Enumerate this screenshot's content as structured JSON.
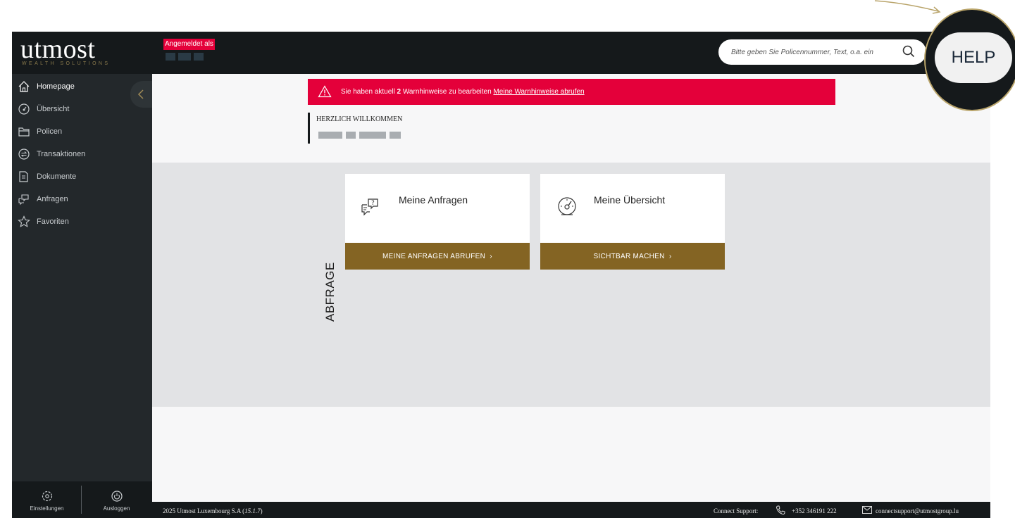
{
  "header": {
    "logo": "utmost",
    "logo_sub": "WEALTH SOLUTIONS",
    "logged_in_label": "Angemeldet als",
    "search_placeholder": "Bitte geben Sie Policennummer, Text, o.a. ein",
    "help_label": "HELP"
  },
  "sidebar": {
    "items": [
      {
        "label": "Homepage",
        "icon": "home-icon",
        "active": true
      },
      {
        "label": "Übersicht",
        "icon": "gauge-icon"
      },
      {
        "label": "Policen",
        "icon": "folder-icon"
      },
      {
        "label": "Transaktionen",
        "icon": "exchange-icon"
      },
      {
        "label": "Dokumente",
        "icon": "document-icon"
      },
      {
        "label": "Anfragen",
        "icon": "chat-icon"
      },
      {
        "label": "Favoriten",
        "icon": "star-icon"
      }
    ],
    "settings_label": "Einstellungen",
    "logout_label": "Ausloggen"
  },
  "warning": {
    "prefix": "Sie haben aktuell",
    "count": "2",
    "middle": "Warnhinweise zu bearbeiten",
    "link": "Meine Warnhinweise abrufen"
  },
  "welcome": {
    "title": "HERZLICH WILLKOMMEN"
  },
  "section": {
    "label": "ABFRAGE"
  },
  "cards": [
    {
      "title": "Meine Anfragen",
      "button": "MEINE ANFRAGEN ABRUFEN",
      "icon": "question-chat-icon"
    },
    {
      "title": "Meine Übersicht",
      "button": "SICHTBAR MACHEN",
      "icon": "speedometer-icon"
    }
  ],
  "footer": {
    "copyright": "2025 Utmost Luxembourg S.A",
    "version": "15.1.7",
    "support_label": "Connect Support:",
    "phone": "+352 346191 222",
    "email": "connectsupport@utmostgroup.lu"
  },
  "colors": {
    "accent": "#846423",
    "alert": "#e4003a",
    "dark": "#15191b"
  }
}
